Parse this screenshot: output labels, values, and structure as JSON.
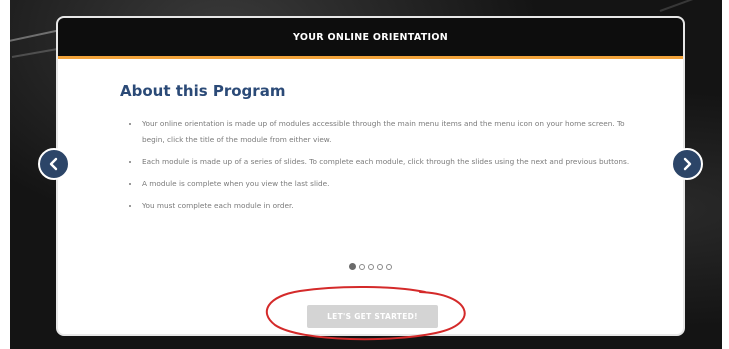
{
  "modal": {
    "title": "YOUR ONLINE ORIENTATION",
    "heading": "About this Program",
    "bullets": [
      "Your online orientation is made up of modules accessible through the main menu items and the menu icon on your home screen. To begin, click the title of the module from either view.",
      "Each module is made up of a series of slides. To complete each module, click through the slides using the next and previous buttons.",
      "A module is complete when you view the last slide.",
      "You must complete each module in order."
    ],
    "pagination": {
      "current": 1,
      "total": 5
    },
    "start_button_label": "LET'S GET STARTED!"
  },
  "navigation": {
    "prev_icon": "chevron-left-icon",
    "next_icon": "chevron-right-icon"
  },
  "colors": {
    "header_bg": "#0d0d0d",
    "header_accent": "#f2a33b",
    "heading": "#2b4a77",
    "nav_button": "#2c4568",
    "button_disabled": "#d4d4d4",
    "annotation_circle": "#d42a2a"
  }
}
